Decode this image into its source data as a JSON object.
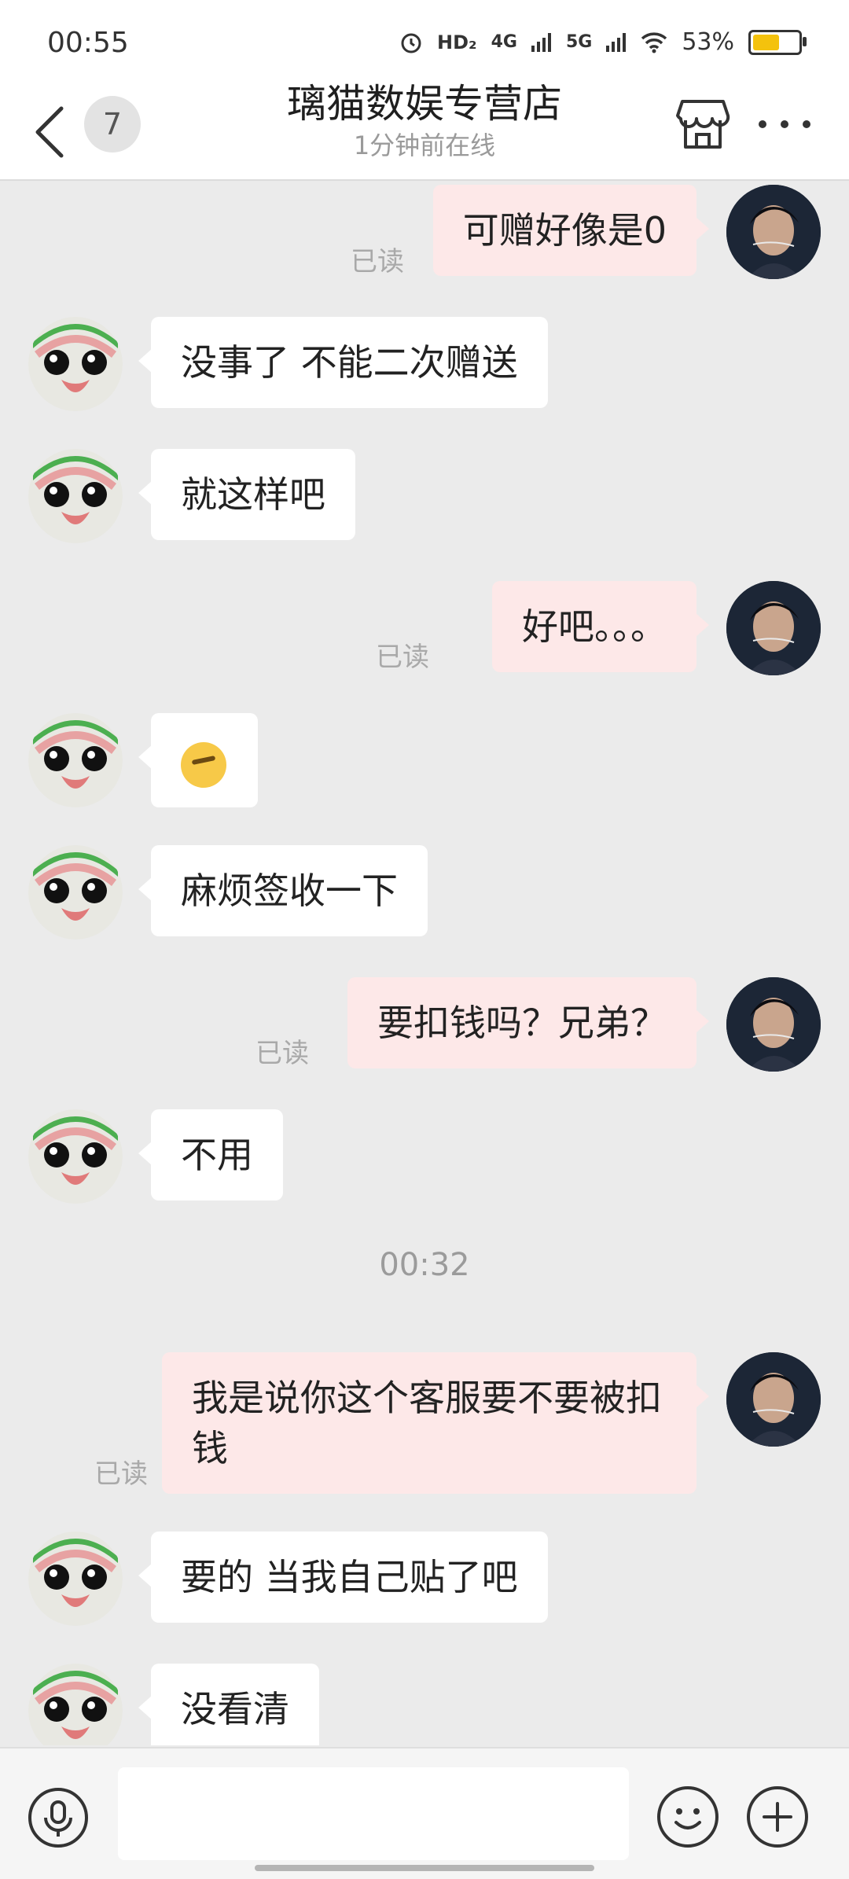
{
  "status_bar": {
    "time": "00:55",
    "hd": "HD₂",
    "net1": "4G",
    "net2": "5G",
    "battery": "53%"
  },
  "header": {
    "unread_count": "7",
    "shop_name": "璃猫数娱专营店",
    "online_status": "1分钟前在线"
  },
  "icons": {
    "back": "chevron-left-icon",
    "store": "store-icon",
    "more": "more-icon",
    "alarm": "alarm-icon",
    "wifi": "wifi-icon",
    "signal": "signal-icon",
    "voice": "microphone-icon",
    "emoji": "smiley-icon",
    "plus": "plus-icon",
    "emoji_reaction": "facepalm-emoji"
  },
  "messages": [
    {
      "side": "out",
      "text": "可赠好像是0",
      "read": "已读"
    },
    {
      "side": "in",
      "text": "没事了 不能二次赠送"
    },
    {
      "side": "in",
      "text": "就这样吧"
    },
    {
      "side": "out",
      "text": "好吧。。。",
      "read": "已读"
    },
    {
      "side": "in",
      "text": ""
    },
    {
      "side": "in",
      "text": "麻烦签收一下"
    },
    {
      "side": "out",
      "text": "要扣钱吗？兄弟？",
      "read": "已读"
    },
    {
      "side": "in",
      "text": "不用"
    },
    {
      "side": "time",
      "text": "00:32"
    },
    {
      "side": "out",
      "text": "我是说你这个客服要不要被扣钱",
      "read": "已读"
    },
    {
      "side": "in",
      "text": "要的 当我自己贴了吧"
    },
    {
      "side": "in",
      "text": "没看清"
    }
  ],
  "colors": {
    "bubble_out": "#fde8e8",
    "bubble_in": "#ffffff",
    "chat_bg": "#ebebeb"
  }
}
